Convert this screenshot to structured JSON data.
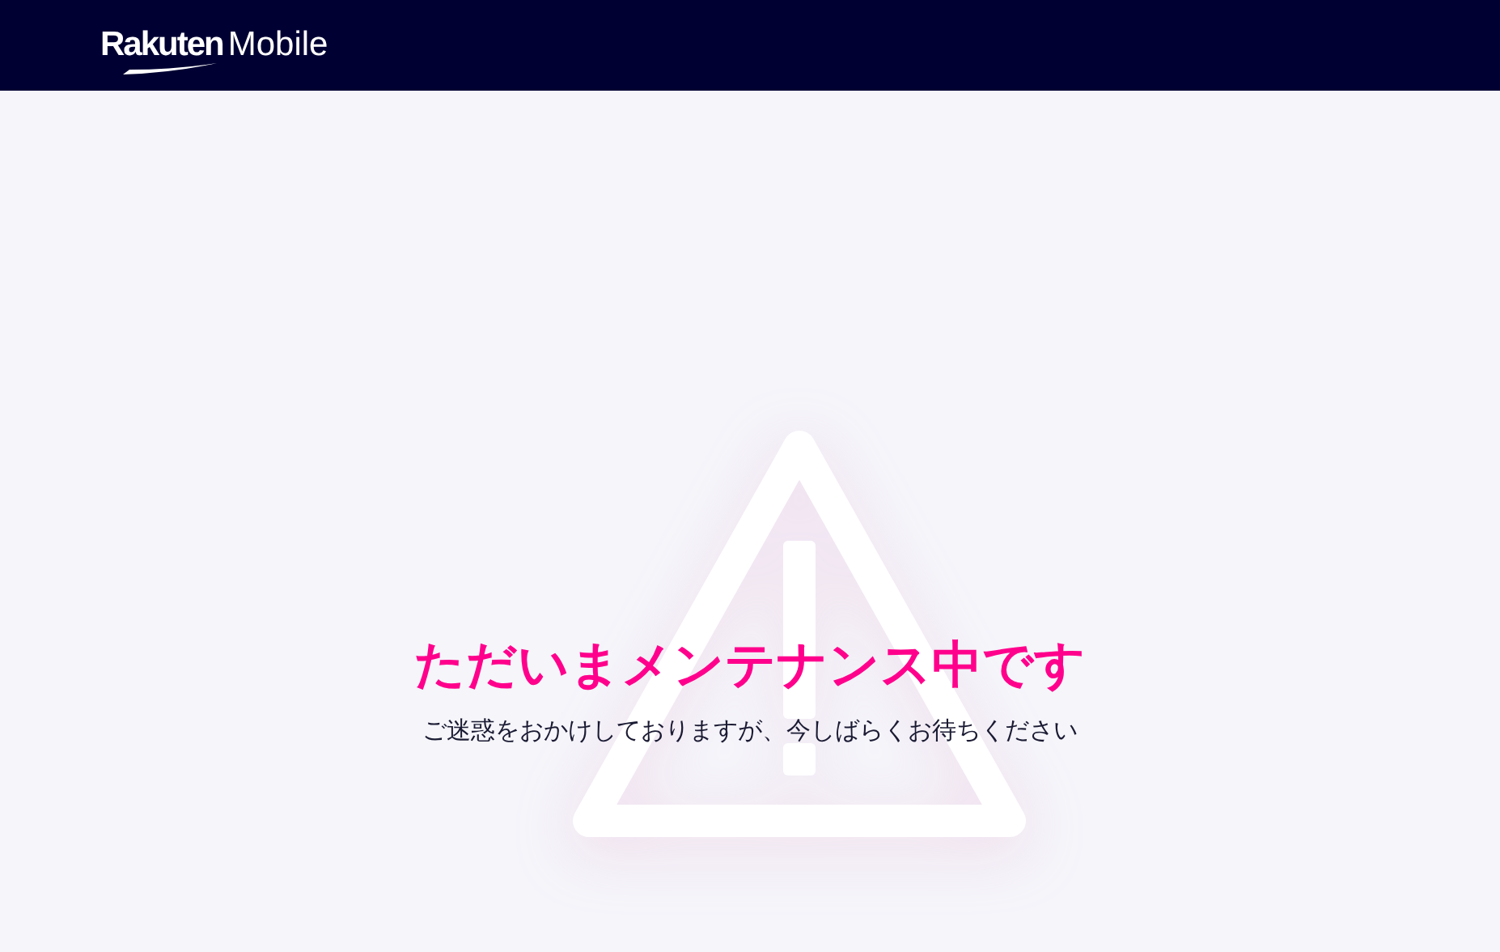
{
  "header": {
    "logo_brand": "Rakuten",
    "logo_product": "Mobile"
  },
  "maintenance": {
    "title": "ただいまメンテナンス中です",
    "message": "ご迷惑をおかけしておりますが、今しばらくお待ちください"
  }
}
